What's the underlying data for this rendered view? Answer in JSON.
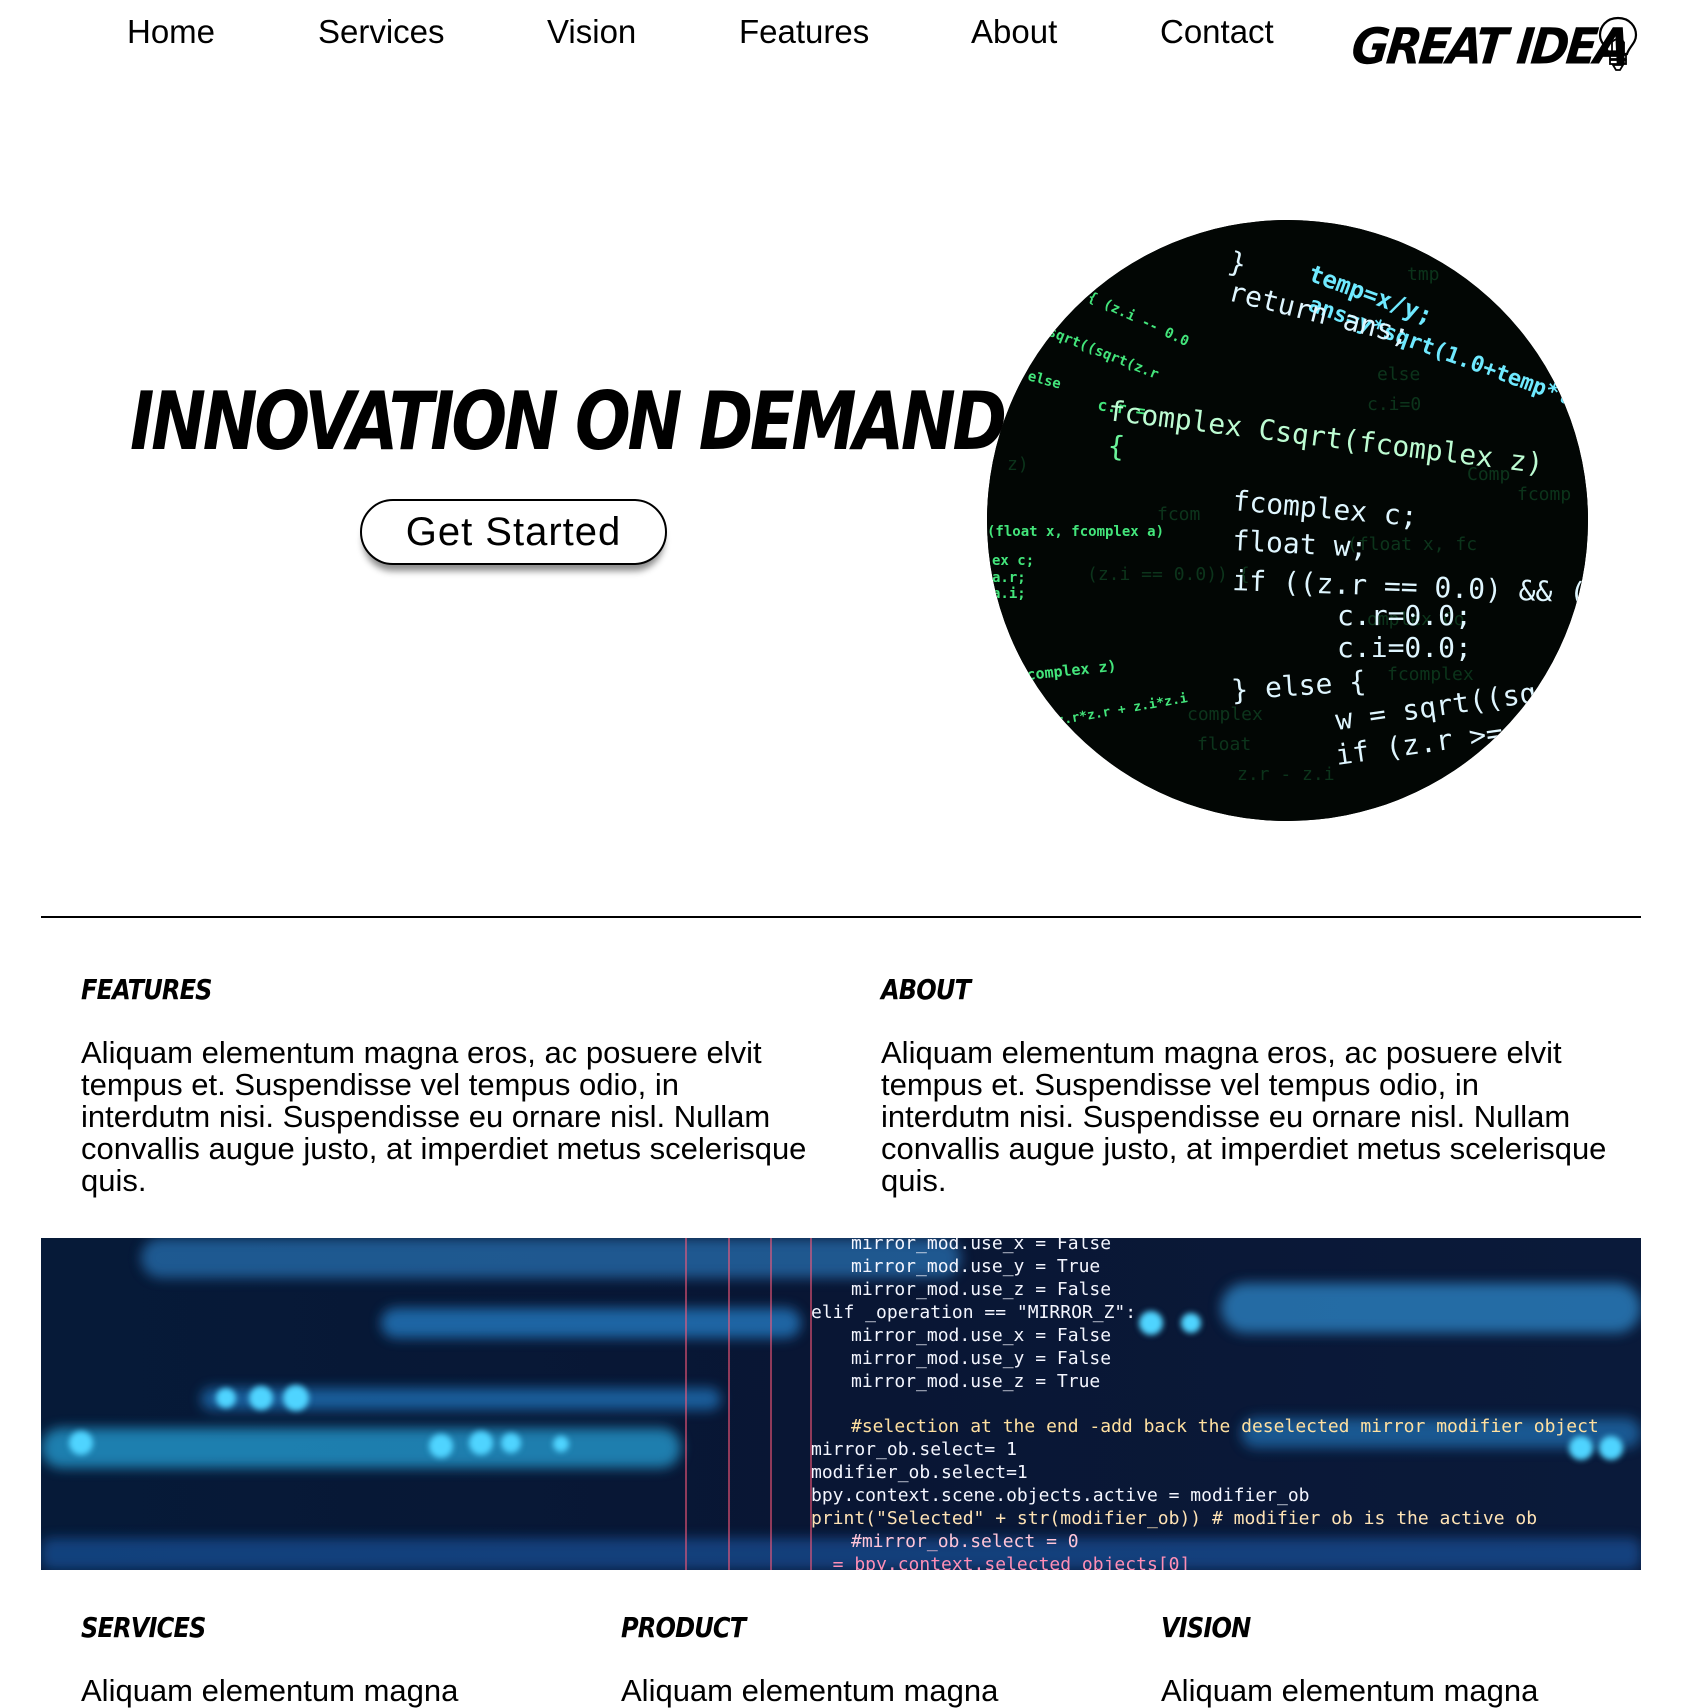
{
  "nav": {
    "items": [
      "Home",
      "Services",
      "Vision",
      "Features",
      "About",
      "Contact"
    ],
    "logo_text": "GREAT IDEA",
    "logo_icon": "lightbulb-icon"
  },
  "hero": {
    "title": "INNOVATION ON DEMAND",
    "cta_label": "Get Started",
    "image_icon": "code-screen-image"
  },
  "features": {
    "title": "FEATURES",
    "body": "Aliquam elementum magna eros, ac posuere elvit tempus et. Suspendisse vel tempus odio, in interdutm nisi. Suspendisse eu ornare nisl. Nullam convallis augue justo, at imperdiet metus scelerisque quis."
  },
  "about": {
    "title": "ABOUT",
    "body": "Aliquam elementum magna eros, ac posuere elvit tempus et. Suspendisse vel tempus odio, in interdutm nisi. Suspendisse eu ornare nisl. Nullam convallis augue justo, at imperdiet metus scelerisque quis."
  },
  "bottom": {
    "services": {
      "title": "SERVICES",
      "body": "Aliquam elementum magna"
    },
    "product": {
      "title": "PRODUCT",
      "body": "Aliquam elementum magna"
    },
    "vision": {
      "title": "VISION",
      "body": "Aliquam elementum magna"
    }
  },
  "colors": {
    "text": "#000000",
    "background": "#ffffff",
    "code_green": "#3ee07a",
    "code_blue": "#2fb7ff",
    "banner_bg": "#07122c"
  }
}
